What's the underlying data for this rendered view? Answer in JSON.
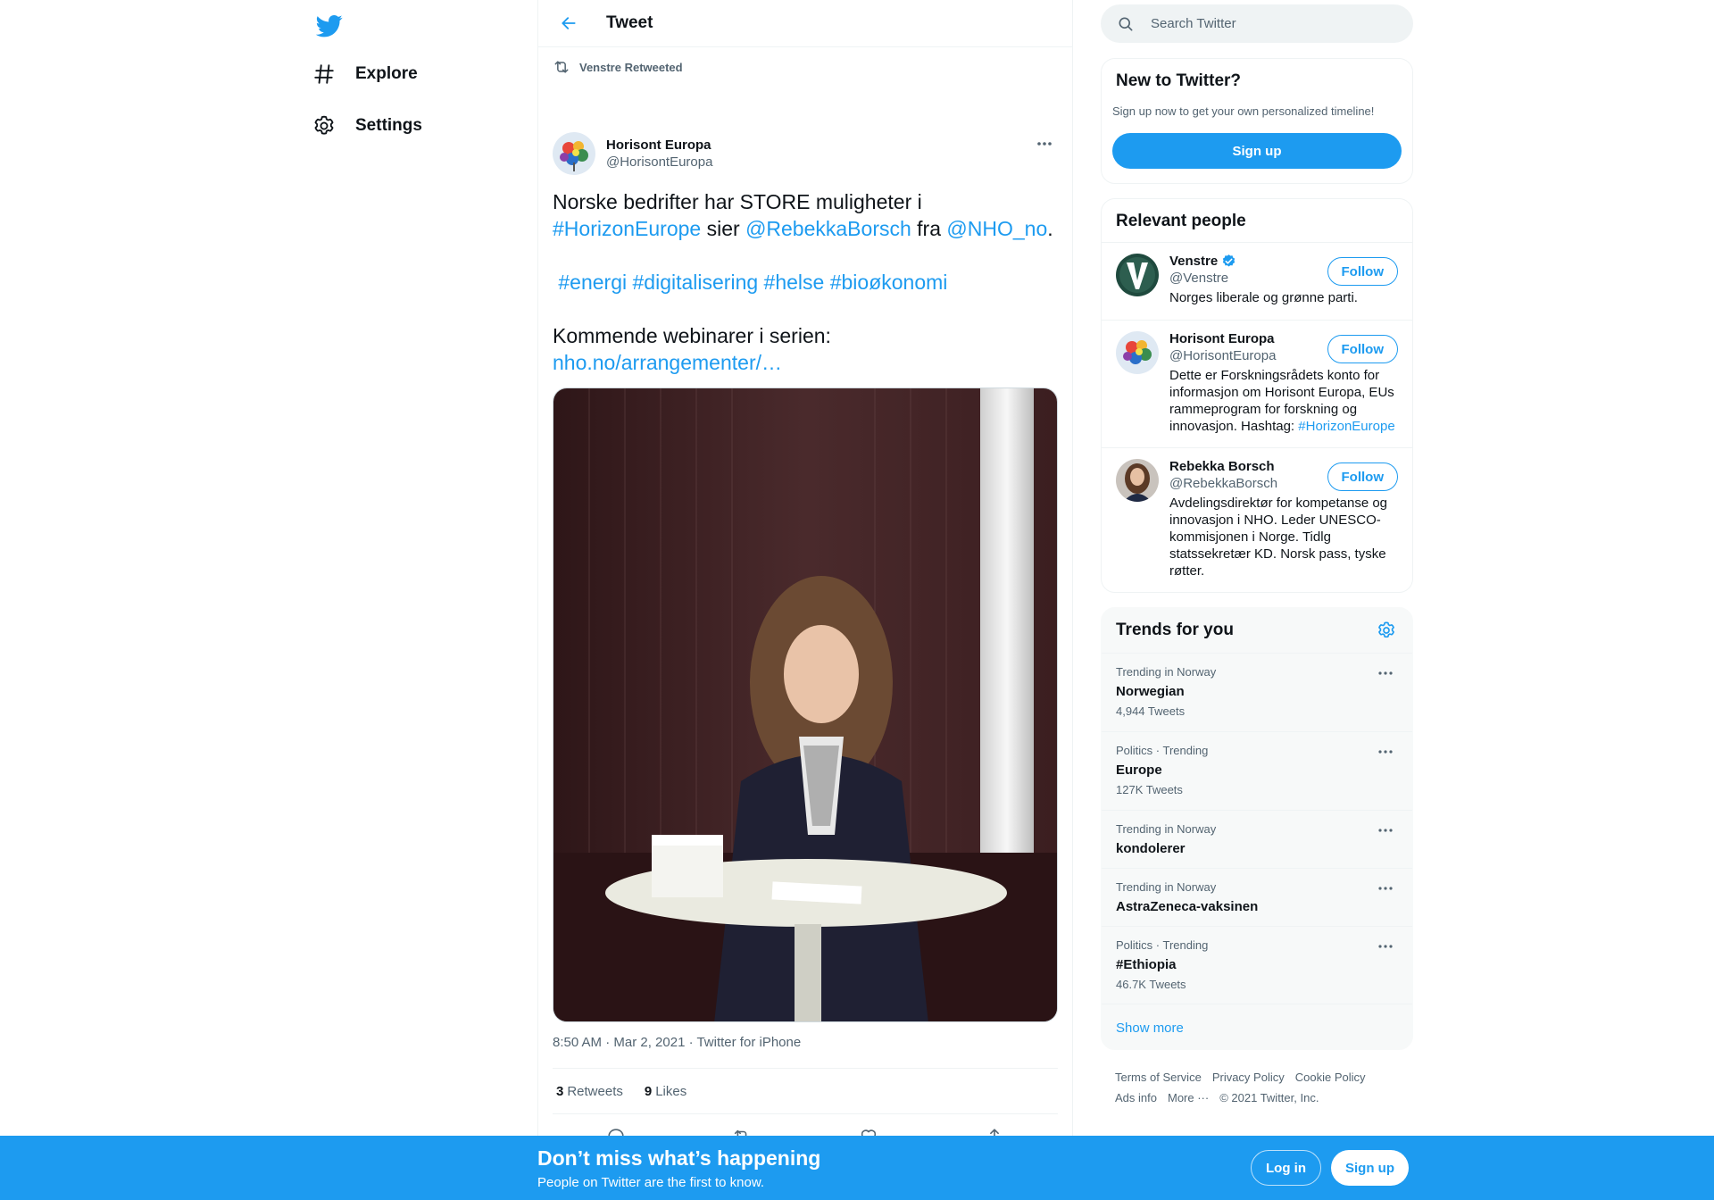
{
  "colors": {
    "brand": "#1d9bf0",
    "text": "#0f1419",
    "muted": "#536471"
  },
  "nav": {
    "logo_icon": "twitter-bird-icon",
    "items": [
      {
        "label": "Explore",
        "icon": "hashtag-icon"
      },
      {
        "label": "Settings",
        "icon": "gear-icon"
      }
    ]
  },
  "header": {
    "title": "Tweet",
    "back_icon": "arrow-left-icon"
  },
  "tweet": {
    "social_context": "Venstre Retweeted",
    "author_name": "Horisont Europa",
    "author_handle": "@HorisontEuropa",
    "text_parts": [
      {
        "t": "Norske bedrifter har STORE muligheter i\n"
      },
      {
        "t": "#HorizonEurope",
        "link": true
      },
      {
        "t": " sier "
      },
      {
        "t": "@RebekkaBorsch",
        "link": true
      },
      {
        "t": " fra "
      },
      {
        "t": "@NHO_no",
        "link": true
      },
      {
        "t": ".\n\n "
      },
      {
        "t": "#energi",
        "link": true
      },
      {
        "t": " "
      },
      {
        "t": "#digitalisering",
        "link": true
      },
      {
        "t": " "
      },
      {
        "t": "#helse",
        "link": true
      },
      {
        "t": " "
      },
      {
        "t": "#bioøkonomi",
        "link": true
      },
      {
        "t": "\n\nKommende webinarer i serien:\n"
      },
      {
        "t": "nho.no/arrangementer/…",
        "link": true
      }
    ],
    "timestamp": "8:50 AM · Mar 2, 2021 · Twitter for iPhone",
    "retweets_count": "3",
    "retweets_label": "Retweets",
    "likes_count": "9",
    "likes_label": "Likes"
  },
  "search": {
    "placeholder": "Search Twitter"
  },
  "new_to_twitter": {
    "title": "New to Twitter?",
    "subtitle": "Sign up now to get your own personalized timeline!",
    "button": "Sign up"
  },
  "relevant_people": {
    "title": "Relevant people",
    "follow_label": "Follow",
    "people": [
      {
        "name": "Venstre",
        "handle": "@Venstre",
        "verified": true,
        "bio": "Norges liberale og grønne parti.",
        "bio_link": ""
      },
      {
        "name": "Horisont Europa",
        "handle": "@HorisontEuropa",
        "verified": false,
        "bio": "Dette er Forskningsrådets konto for informasjon om Horisont Europa, EUs rammeprogram for forskning og innovasjon. Hashtag: ",
        "bio_link": "#HorizonEurope"
      },
      {
        "name": "Rebekka Borsch",
        "handle": "@RebekkaBorsch",
        "verified": false,
        "bio": "Avdelingsdirektør for kompetanse og innovasjon i NHO. Leder UNESCO-kommisjonen i Norge. Tidlg statssekretær KD. Norsk pass, tyske røtter.",
        "bio_link": ""
      }
    ]
  },
  "trends": {
    "title": "Trends for you",
    "items": [
      {
        "context": "Trending in Norway",
        "name": "Norwegian",
        "count": "4,944 Tweets"
      },
      {
        "context": "Politics · Trending",
        "name": "Europe",
        "count": "127K Tweets"
      },
      {
        "context": "Trending in Norway",
        "name": "kondolerer",
        "count": ""
      },
      {
        "context": "Trending in Norway",
        "name": "AstraZeneca-vaksinen",
        "count": ""
      },
      {
        "context": "Politics · Trending",
        "name": "#Ethiopia",
        "count": "46.7K Tweets"
      }
    ],
    "show_more": "Show more"
  },
  "footer": {
    "links": [
      "Terms of Service",
      "Privacy Policy",
      "Cookie Policy",
      "Ads info",
      "More ···"
    ],
    "copyright": "© 2021 Twitter, Inc."
  },
  "bottom_bar": {
    "title": "Don’t miss what’s happening",
    "subtitle": "People on Twitter are the first to know.",
    "login": "Log in",
    "signup": "Sign up"
  }
}
